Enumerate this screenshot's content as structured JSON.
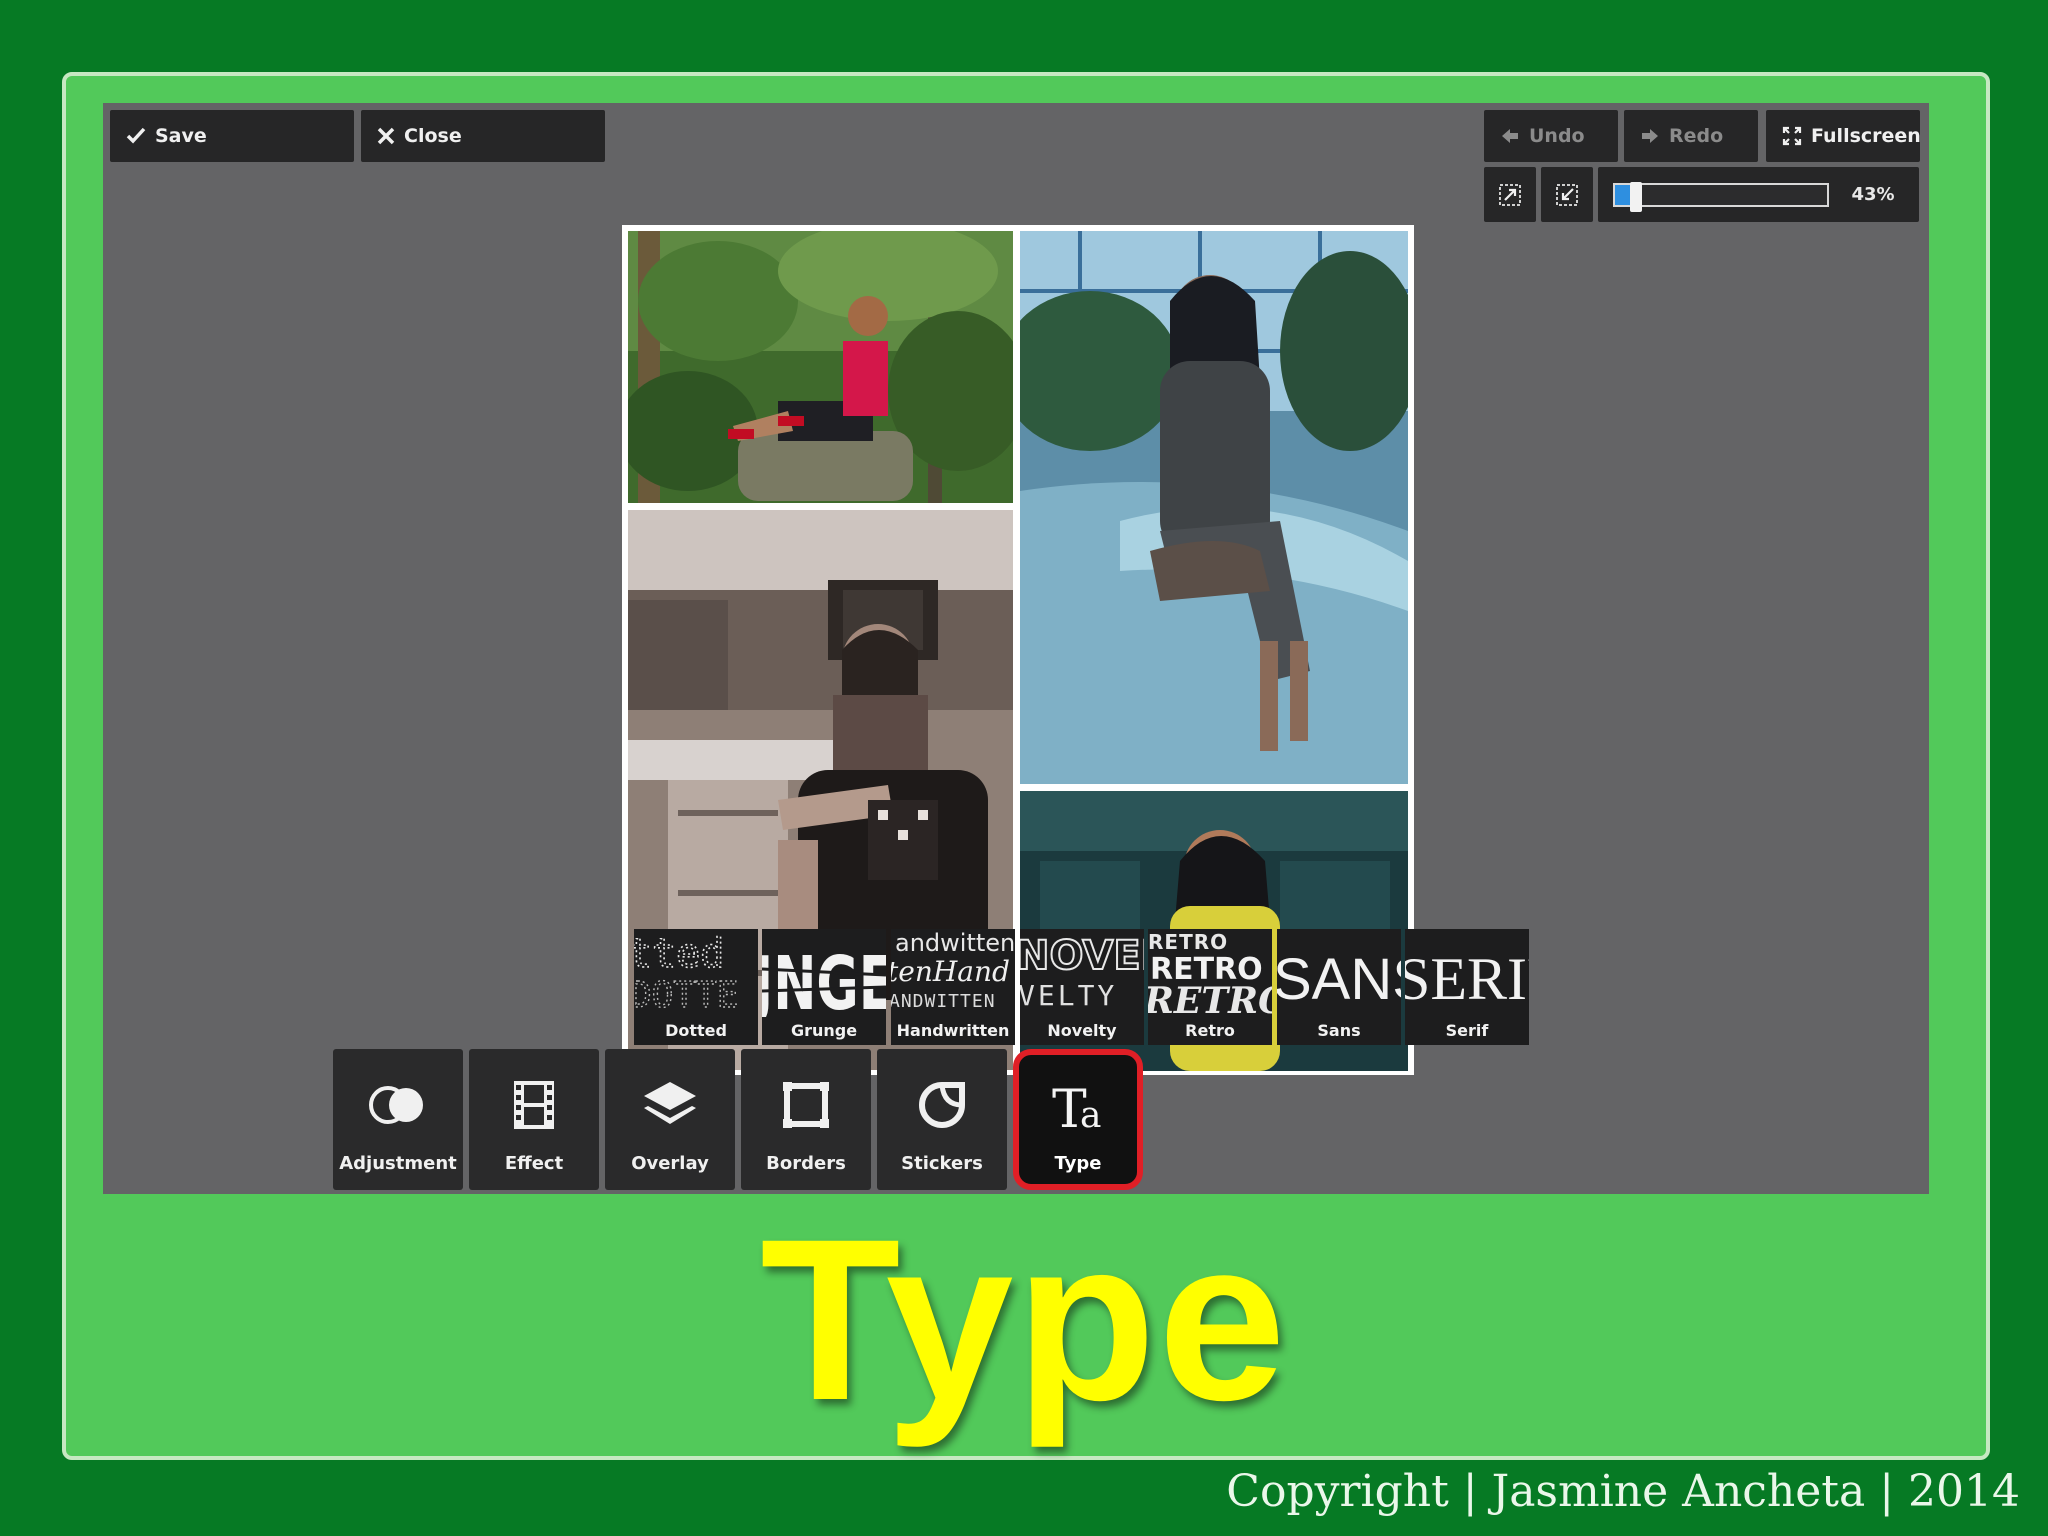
{
  "toolbar": {
    "save_label": "Save",
    "close_label": "Close",
    "undo_label": "Undo",
    "redo_label": "Redo",
    "fullscreen_label": "Fullscreen"
  },
  "zoom": {
    "percent_label": "43%",
    "level": 0.1
  },
  "font_styles": [
    {
      "label": "Dotted",
      "sample": "tted DOTTE"
    },
    {
      "label": "Grunge",
      "sample": "JNGE"
    },
    {
      "label": "Handwritten",
      "sample": "andwitten tenHand ANDWITTEN"
    },
    {
      "label": "Novelty",
      "sample": "NOVEL VELTY"
    },
    {
      "label": "Retro",
      "sample": "RETRO RETRO RETRO"
    },
    {
      "label": "Sans",
      "sample": "SANS"
    },
    {
      "label": "Serif",
      "sample": "SERIF"
    }
  ],
  "tools": [
    {
      "label": "Adjustment",
      "icon": "adjustment-icon"
    },
    {
      "label": "Effect",
      "icon": "film-icon"
    },
    {
      "label": "Overlay",
      "icon": "layers-icon"
    },
    {
      "label": "Borders",
      "icon": "frame-icon"
    },
    {
      "label": "Stickers",
      "icon": "sticker-icon"
    },
    {
      "label": "Type",
      "icon": "type-icon"
    }
  ],
  "active_tool": "Type",
  "slide_title": "Type",
  "copyright": "Copyright | Jasmine Ancheta | 2014",
  "colors": {
    "background": "#067a24",
    "slide": "#52c95a",
    "editor": "#646466",
    "title": "#ffff00",
    "highlight": "#e01f26",
    "zoom_fill": "#2e8fe0"
  }
}
